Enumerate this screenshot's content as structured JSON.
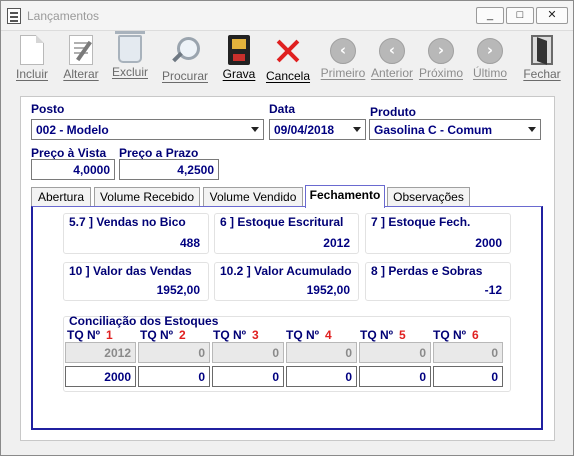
{
  "window": {
    "title": "Lançamentos",
    "min": "_",
    "max": "□",
    "close": "✕"
  },
  "toolbar": [
    {
      "label": "Incluir",
      "state": "normal"
    },
    {
      "label": "Alterar",
      "state": "normal"
    },
    {
      "label": "Excluir",
      "state": "normal"
    },
    {
      "label": "Procurar",
      "state": "normal"
    },
    {
      "label": "Grava",
      "state": "active"
    },
    {
      "label": "Cancela",
      "state": "active"
    },
    {
      "label": "Primeiro",
      "state": "disabled"
    },
    {
      "label": "Anterior",
      "state": "disabled"
    },
    {
      "label": "Próximo",
      "state": "disabled"
    },
    {
      "label": "Último",
      "state": "disabled"
    },
    {
      "label": "Fechar",
      "state": "normal"
    }
  ],
  "form": {
    "posto_label": "Posto",
    "posto_value": "002 - Modelo",
    "data_label": "Data",
    "data_value": "09/04/2018",
    "produto_label": "Produto",
    "produto_value": "Gasolina C - Comum",
    "preco_vista_label": "Preço à Vista",
    "preco_vista_value": "4,0000",
    "preco_prazo_label": "Preço a Prazo",
    "preco_prazo_value": "4,2500"
  },
  "tabs": [
    "Abertura",
    "Volume Recebido",
    "Volume Vendido",
    "Fechamento",
    "Observações"
  ],
  "active_tab": "Fechamento",
  "fechamento": {
    "vendas_bico_label": "5.7 ] Vendas no Bico",
    "vendas_bico_value": "488",
    "estoque_escritural_label": "6 ] Estoque Escritural",
    "estoque_escritural_value": "2012",
    "estoque_fech_label": "7 ] Estoque Fech.",
    "estoque_fech_value": "2000",
    "valor_vendas_label": "10 ] Valor das Vendas",
    "valor_vendas_value": "1952,00",
    "valor_acumulado_label": "10.2 ] Valor Acumulado",
    "valor_acumulado_value": "1952,00",
    "perdas_sobras_label": "8 ] Perdas e Sobras",
    "perdas_sobras_value": "-12",
    "conciliacao_label": "Conciliação dos Estoques",
    "tq_prefix": "TQ Nº",
    "tanks": [
      {
        "num": "1",
        "escritural": "2012",
        "fisico": "2000"
      },
      {
        "num": "2",
        "escritural": "0",
        "fisico": "0"
      },
      {
        "num": "3",
        "escritural": "0",
        "fisico": "0"
      },
      {
        "num": "4",
        "escritural": "0",
        "fisico": "0"
      },
      {
        "num": "5",
        "escritural": "0",
        "fisico": "0"
      },
      {
        "num": "6",
        "escritural": "0",
        "fisico": "0"
      }
    ]
  }
}
